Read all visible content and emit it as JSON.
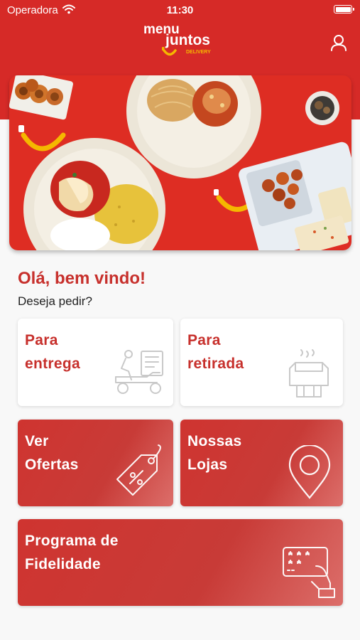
{
  "status_bar": {
    "carrier": "Operadora",
    "time": "11:30"
  },
  "logo": {
    "word1": "menu",
    "word2": "juntos",
    "tag": "DELIVERY"
  },
  "greeting": {
    "title": "Olá, bem vindo!",
    "subtitle": "Deseja pedir?"
  },
  "cards": {
    "delivery": {
      "line1": "Para",
      "line2": "entrega",
      "icon": "delivery-scooter-icon"
    },
    "pickup": {
      "line1": "Para",
      "line2": "retirada",
      "icon": "pickup-bag-icon"
    },
    "offers": {
      "line1": "Ver",
      "line2": "Ofertas",
      "icon": "discount-tag-icon"
    },
    "stores": {
      "line1": "Nossas",
      "line2": "Lojas",
      "icon": "map-pin-icon"
    },
    "loyalty": {
      "line1": "Programa de",
      "line2": "Fidelidade",
      "icon": "loyalty-card-hand-icon"
    }
  },
  "colors": {
    "brand_red": "#d62a27",
    "title_red": "#c7302c",
    "accent_yellow": "#f5b800"
  }
}
